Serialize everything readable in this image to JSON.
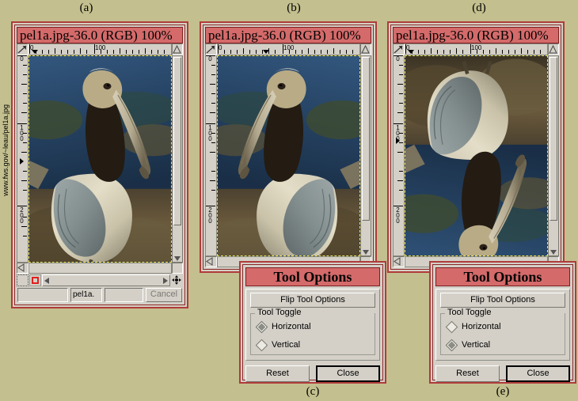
{
  "figure": {
    "labels": [
      {
        "id": "a",
        "text": "(a)"
      },
      {
        "id": "b",
        "text": "(b)"
      },
      {
        "id": "c",
        "text": "(c)"
      },
      {
        "id": "d",
        "text": "(d)"
      },
      {
        "id": "e",
        "text": "(e)"
      }
    ],
    "background_color": "#c3bf8e",
    "caption_url": "www.fws.gov/~leau/pel1a.jpg"
  },
  "windows": [
    {
      "id": "a",
      "title": "pel1a.jpg-36.0 (RGB) 100%",
      "ruler": {
        "h_labels": [
          "0",
          "100"
        ],
        "v_labels": [
          "0",
          "100",
          "200"
        ],
        "unit": "px"
      },
      "statusbar": {
        "left": "",
        "name": "pel1a.",
        "progress": "",
        "cancel_label": "Cancel"
      },
      "image_state": "original"
    },
    {
      "id": "b",
      "title": "pel1a.jpg-36.0 (RGB) 100%",
      "ruler": {
        "h_labels": [
          "0",
          "100"
        ],
        "v_labels": [
          "0",
          "100",
          "200"
        ],
        "unit": "px"
      },
      "image_state": "flipped-horizontal"
    },
    {
      "id": "d",
      "title": "pel1a.jpg-36.0 (RGB) 100%",
      "ruler": {
        "h_labels": [
          "0",
          "100"
        ],
        "v_labels": [
          "0",
          "100",
          "200"
        ],
        "unit": "px"
      },
      "image_state": "flipped-vertical"
    }
  ],
  "dialogs": [
    {
      "id": "c",
      "title": "Tool Options",
      "flip_button_label": "Flip Tool Options",
      "group_label": "Tool Toggle",
      "options": [
        {
          "label": "Horizontal",
          "selected": true
        },
        {
          "label": "Vertical",
          "selected": false
        }
      ],
      "reset_label": "Reset",
      "close_label": "Close"
    },
    {
      "id": "e",
      "title": "Tool Options",
      "flip_button_label": "Flip Tool Options",
      "group_label": "Tool Toggle",
      "options": [
        {
          "label": "Horizontal",
          "selected": false
        },
        {
          "label": "Vertical",
          "selected": true
        }
      ],
      "reset_label": "Reset",
      "close_label": "Close"
    }
  ],
  "colors": {
    "titlebar": "#d46a6a",
    "window_border": "#b03b3b",
    "desktop": "#c3bf8e",
    "chrome": "#d4d0c8",
    "selection_dash": "#f2e34a"
  }
}
